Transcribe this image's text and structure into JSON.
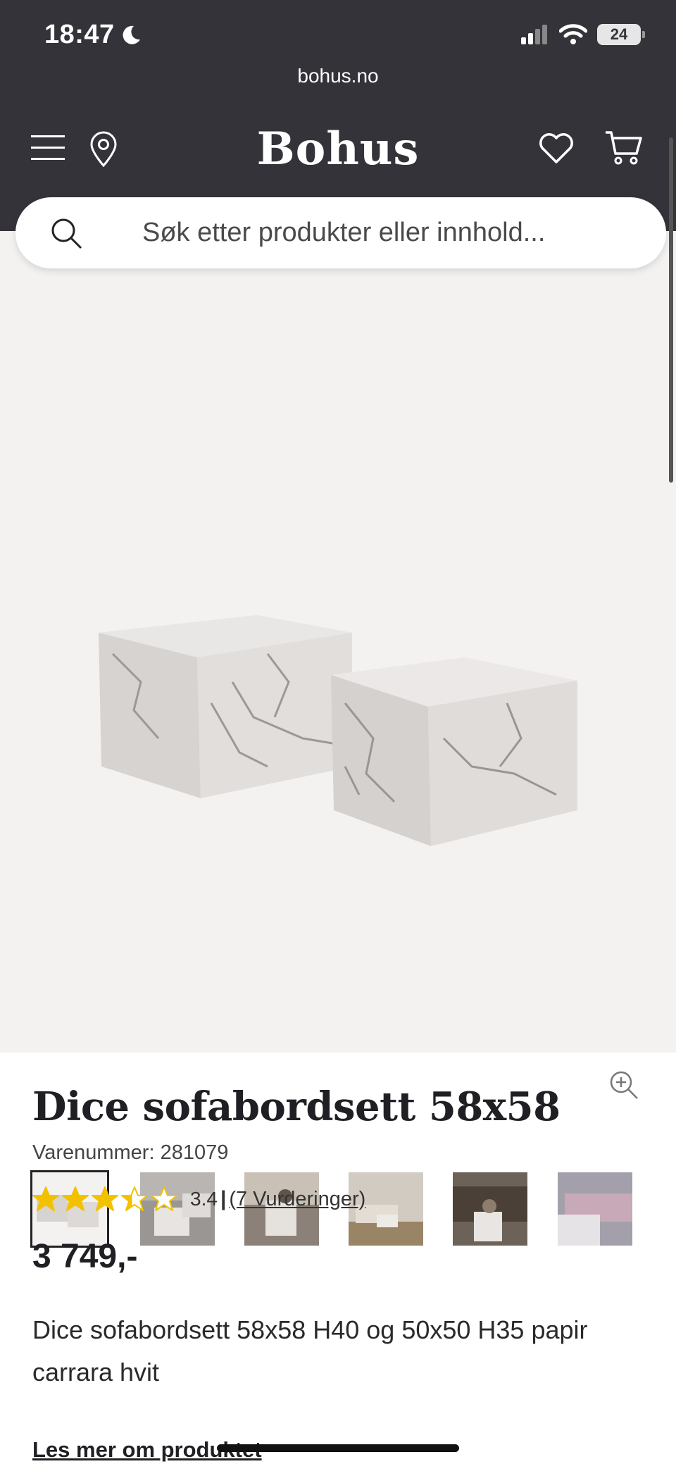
{
  "status_bar": {
    "time": "18:47",
    "battery": "24",
    "icons": [
      "moon-icon",
      "signal-icon",
      "wifi-icon",
      "battery-icon"
    ]
  },
  "browser": {
    "url": "bohus.no"
  },
  "header": {
    "logo": "Bohus",
    "icons": [
      "menu-icon",
      "store-locator-icon",
      "wishlist-icon",
      "cart-icon"
    ],
    "background": "#343339"
  },
  "search": {
    "placeholder": "Søk etter produkter eller innhold..."
  },
  "gallery": {
    "background": "#f4f2f1",
    "thumbnail_count": 6,
    "active_thumbnail": 1,
    "zoom_icon": "zoom-in-icon"
  },
  "product": {
    "title": "Dice sofabordsett 58x58",
    "sku": "Varenummer: 281079",
    "rating": {
      "stars": 3.4,
      "max": 5,
      "value_label": "3.4",
      "separator": "|",
      "reviews_label": "(7 Vurderinger)"
    },
    "price": "3 749,-",
    "description": "Dice sofabordsett 58x58 H40 og 50x50 H35 papir carrara hvit",
    "read_more": "Les mer om produktet"
  },
  "colors": {
    "star": "#f2c200",
    "text": "#1f1f24"
  }
}
